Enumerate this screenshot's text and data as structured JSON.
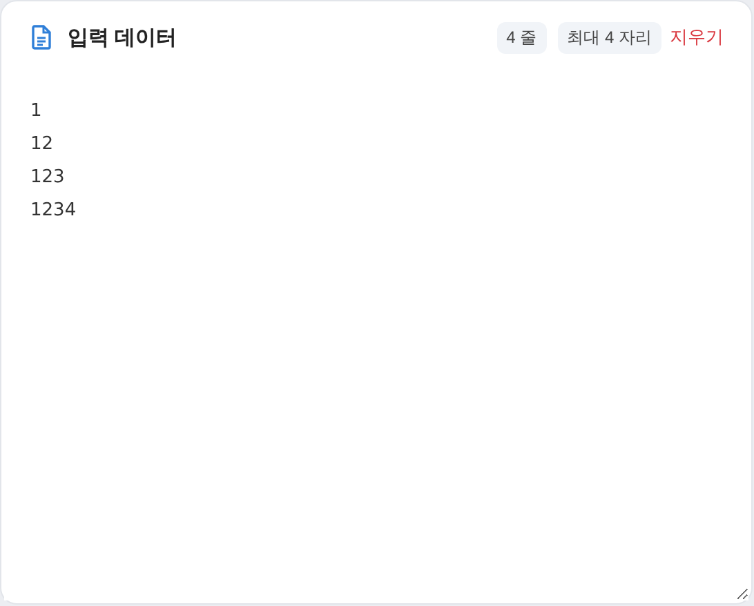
{
  "header": {
    "title": "입력 데이터",
    "badges": [
      "4 줄",
      "최대 4 자리"
    ],
    "clear_button": "지우기"
  },
  "input": {
    "lines": [
      "1",
      "12",
      "123",
      "1234"
    ]
  }
}
